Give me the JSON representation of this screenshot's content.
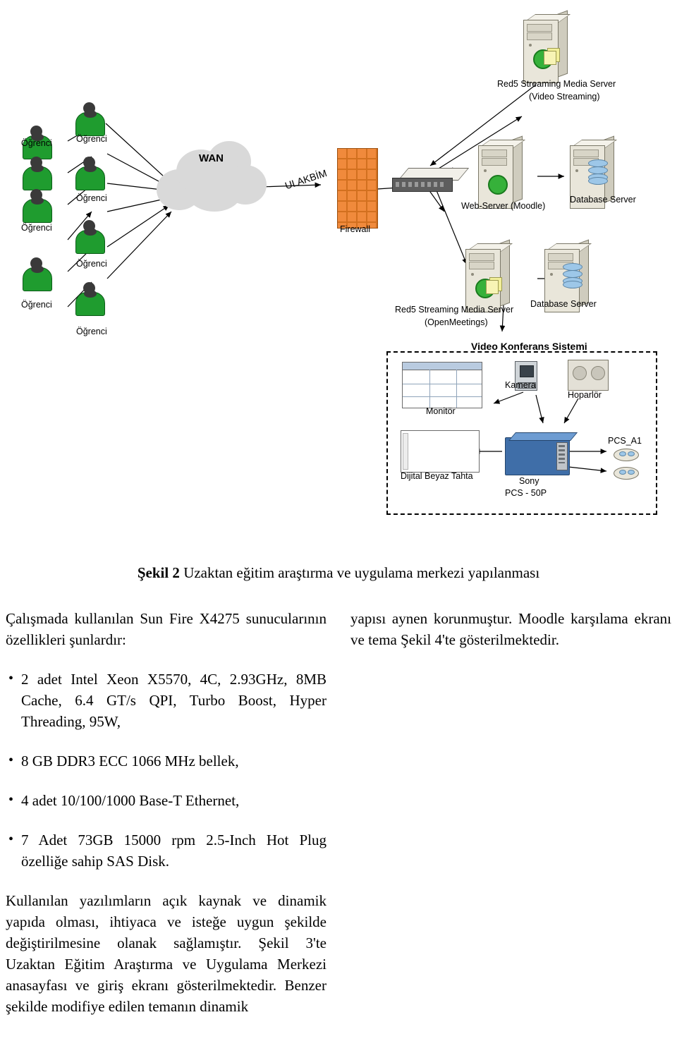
{
  "diagram": {
    "title": "Uzaktan eğitim araştırma ve uygulama merkezi yapılanması",
    "students": [
      {
        "label": "Öğrenci"
      },
      {
        "label": "Öğrenci"
      },
      {
        "label": "Öğrenci"
      },
      {
        "label": "Öğrenci"
      },
      {
        "label": "Öğrenci"
      },
      {
        "label": "Öğrenci"
      },
      {
        "label": "Öğrenci"
      },
      {
        "label": "Öğrenci"
      }
    ],
    "network": {
      "cloud_label": "WAN",
      "backbone_label": "ULAKBİM",
      "firewall_label": "Firewall",
      "switch_label": ""
    },
    "servers": [
      {
        "label_line1": "Red5 Streaming Media Server",
        "label_line2": "(Video Streaming)"
      },
      {
        "label_line1": "Web-Server (Moodle)",
        "label_line2": ""
      },
      {
        "label_line1": "Database Server",
        "label_line2": ""
      },
      {
        "label_line1": "Red5 Streaming Media Server",
        "label_line2": "(OpenMeetings)"
      },
      {
        "label_line1": "Database Server",
        "label_line2": ""
      }
    ],
    "video_conf": {
      "box_title": "Video Konferans Sistemi",
      "monitor": "Monitör",
      "camera": "Kamera",
      "speaker": "Hoparlör",
      "whiteboard": "Dijital Beyaz Tahta",
      "codec_line1": "Sony",
      "codec_line2": "PCS - 50P",
      "pcs_label": "PCS_A1"
    }
  },
  "figure_caption": {
    "number": "Şekil 2",
    "text": "Uzaktan eğitim araştırma ve uygulama merkezi yapılanması"
  },
  "body": {
    "left_intro": "Çalışmada kullanılan Sun Fire X4275 sunucularının özellikleri şunlardır:",
    "bullets": [
      "2 adet Intel Xeon X5570, 4C, 2.93GHz, 8MB Cache, 6.4 GT/s QPI, Turbo Boost, Hyper Threading, 95W,",
      "8 GB DDR3 ECC 1066 MHz bellek,",
      "4 adet 10/100/1000 Base-T Ethernet,",
      "7 Adet 73GB 15000 rpm 2.5-Inch Hot Plug özelliğe sahip SAS Disk."
    ],
    "left_paragraph": "Kullanılan yazılımların açık kaynak ve dinamik yapıda olması, ihtiyaca ve isteğe uygun şekilde değiştirilmesine olanak sağlamıştır. Şekil 3'te Uzaktan Eğitim Araştırma ve Uygulama Merkezi anasayfası ve giriş ekranı gösterilmektedir. Benzer şekilde modifiye edilen temanın dinamik",
    "right_paragraph": "yapısı aynen korunmuştur. Moodle karşılama ekranı ve tema Şekil 4'te gösterilmektedir."
  }
}
